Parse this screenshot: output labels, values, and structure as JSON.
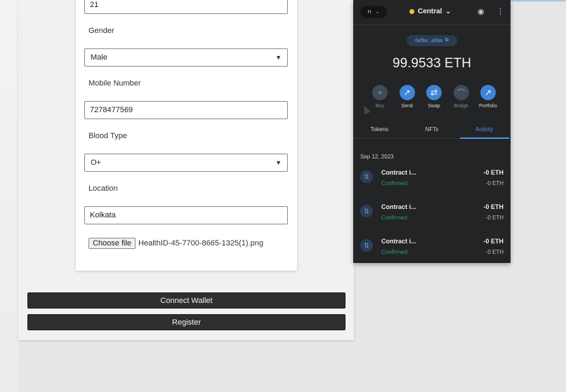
{
  "form": {
    "age_value": "21",
    "gender_label": "Gender",
    "gender_value": "Male",
    "mobile_label": "Mobile Number",
    "mobile_value": "7278477569",
    "blood_label": "Blood Type",
    "blood_value": "O+",
    "location_label": "Location",
    "location_value": "Kolkata",
    "file_button": "Choose file",
    "file_name": "HealthID-45-7700-8665-1325(1).png",
    "connect_label": "Connect Wallet",
    "register_label": "Register"
  },
  "wallet": {
    "network_short": "H",
    "account_name": "Central",
    "address": "0xf9a...a99a",
    "balance": "99.9533 ETH",
    "actions": [
      {
        "label": "Buy",
        "glyph": "+",
        "icon": "plus-icon",
        "enabled": false
      },
      {
        "label": "Send",
        "glyph": "↗",
        "icon": "send-arrow-icon",
        "enabled": true
      },
      {
        "label": "Swap",
        "glyph": "⇄",
        "icon": "swap-icon",
        "enabled": true
      },
      {
        "label": "Bridge",
        "glyph": "⌒",
        "icon": "bridge-icon",
        "enabled": false
      },
      {
        "label": "Portfolio",
        "glyph": "↗",
        "icon": "chart-icon",
        "enabled": true
      }
    ],
    "tabs": [
      {
        "label": "Tokens",
        "active": false
      },
      {
        "label": "NFTs",
        "active": false
      },
      {
        "label": "Activity",
        "active": true
      }
    ],
    "date_header": "Sep 12, 2023",
    "transactions": [
      {
        "title": "Contract i...",
        "status": "Confirmed",
        "amount": "-0 ETH",
        "sub_amount": "-0 ETH"
      },
      {
        "title": "Contract i...",
        "status": "Confirmed",
        "amount": "-0 ETH",
        "sub_amount": "-0 ETH"
      },
      {
        "title": "Contract i...",
        "status": "Confirmed",
        "amount": "-0 ETH",
        "sub_amount": "-0 ETH"
      }
    ]
  },
  "colors": {
    "wallet_bg": "#232426",
    "accent_blue": "#3d86d6",
    "confirmed_green": "#2e9e5f",
    "button_dark": "#2f2f2f"
  }
}
